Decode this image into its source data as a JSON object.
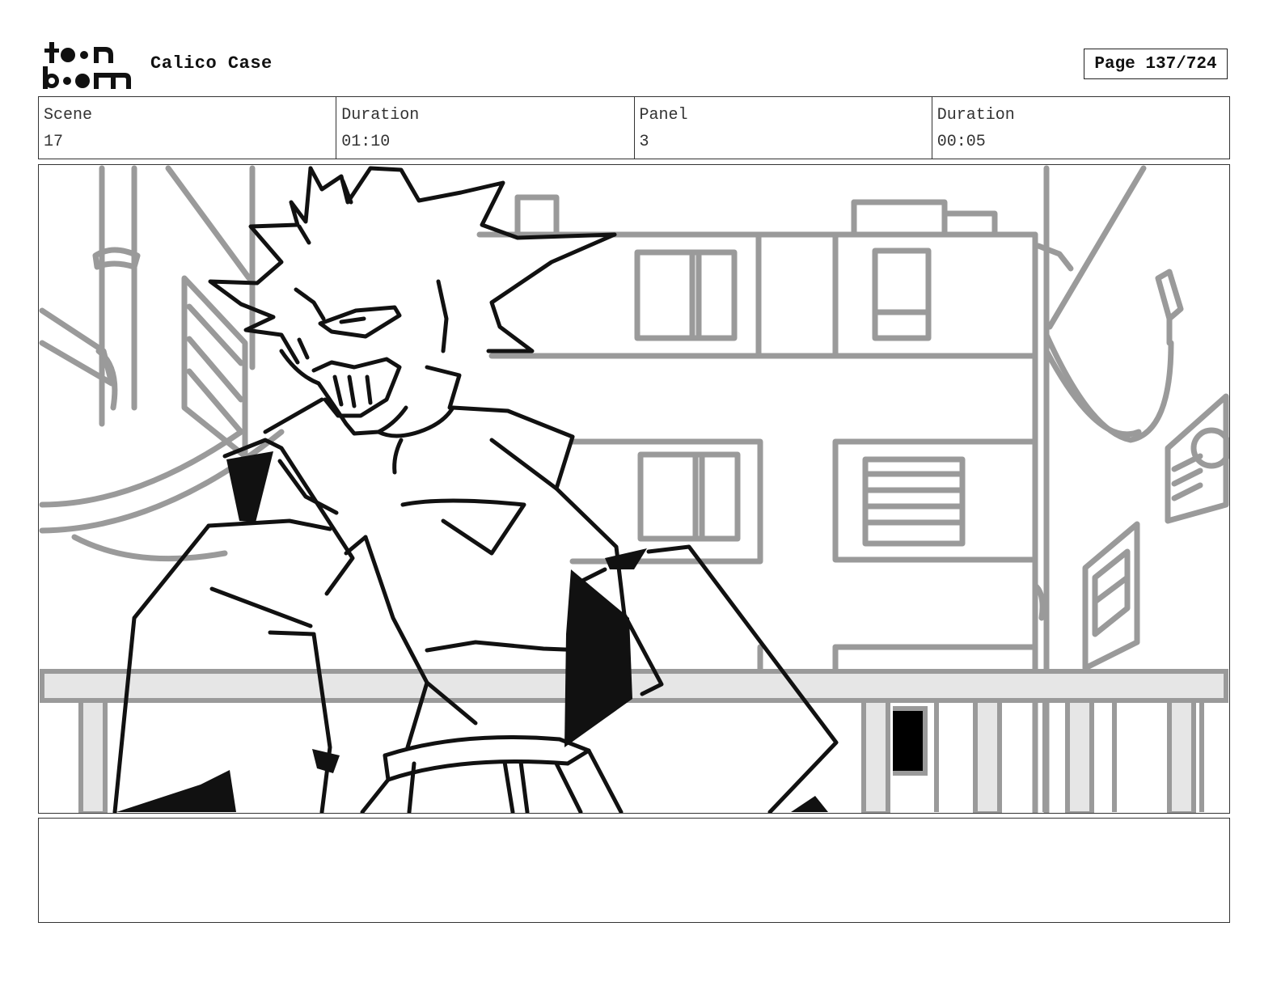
{
  "header": {
    "logo_text": [
      "toon",
      "boom"
    ],
    "project_title": "Calico Case",
    "page_label": "Page 137/724"
  },
  "info": {
    "scene_label": "Scene",
    "scene_value": "17",
    "scene_duration_label": "Duration",
    "scene_duration_value": "01:10",
    "panel_label": "Panel",
    "panel_value": "3",
    "panel_duration_label": "Duration",
    "panel_duration_value": "00:05"
  },
  "panel": {
    "image_content": "storyboard-sketch"
  },
  "notes": {
    "text": ""
  },
  "colors": {
    "ink": "#111111",
    "background_lines": "#9a9a9a",
    "railing_fill": "#e6e6e6"
  }
}
